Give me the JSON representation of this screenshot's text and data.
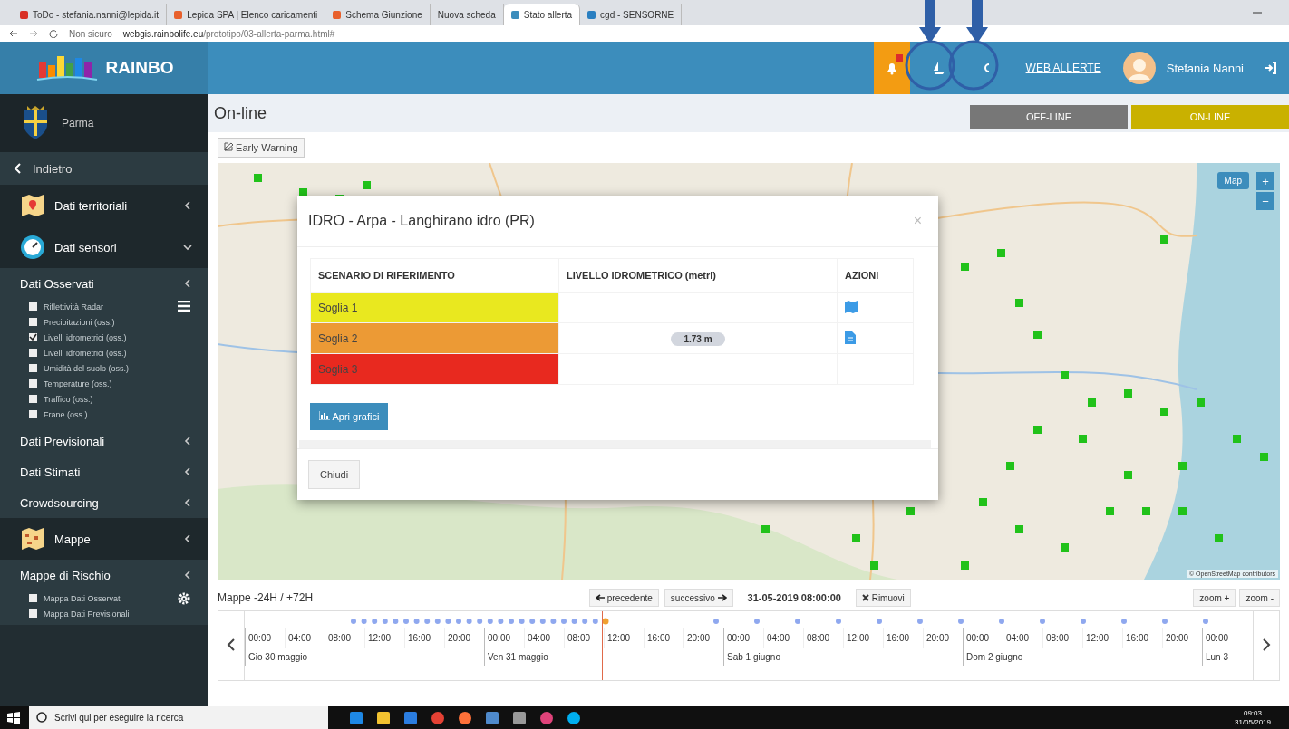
{
  "browser": {
    "tabs": [
      {
        "title": "ToDo - stefania.nanni@lepida.it",
        "selected": false,
        "color": "#d93025"
      },
      {
        "title": "Lepida SPA | Elenco caricamenti",
        "selected": false,
        "color": "#e8602c"
      },
      {
        "title": "Schema Giunzione",
        "selected": false,
        "color": "#e8602c"
      },
      {
        "title": "Nuova scheda",
        "selected": false
      },
      {
        "title": "Stato allerta",
        "selected": true,
        "color": "#3c8dbc"
      },
      {
        "title": "cgd - SENSORNE",
        "selected": false,
        "color": "#2a7fc1"
      }
    ],
    "address": {
      "security": "Non sicuro",
      "url_host": "webgis.rainbolife.eu",
      "url_path": "/prototipo/03-allerta-parma.html#"
    }
  },
  "header": {
    "logo": "RAINBO",
    "alert_active": true,
    "link": "WEB ALLERTE",
    "user": "Stefania Nanni"
  },
  "sidebar": {
    "place": "Parma",
    "back": "Indietro",
    "items": [
      {
        "kind": "main",
        "label": "Dati territoriali",
        "expanded": false
      },
      {
        "kind": "main",
        "label": "Dati sensori",
        "expanded": true
      },
      {
        "kind": "group",
        "label": "Dati Osservati",
        "expanded": false,
        "children": [
          {
            "label": "Riflettività Radar",
            "checked": false
          },
          {
            "label": "Precipitazioni (oss.)",
            "checked": false
          },
          {
            "label": "Livelli idrometrici (oss.)",
            "checked": true
          },
          {
            "label": "Livelli idrometrici (oss.)",
            "checked": false
          },
          {
            "label": "Umidità del suolo (oss.)",
            "checked": false
          },
          {
            "label": "Temperature (oss.)",
            "checked": false
          },
          {
            "label": "Traffico (oss.)",
            "checked": false
          },
          {
            "label": "Frane (oss.)",
            "checked": false
          }
        ]
      },
      {
        "kind": "group",
        "label": "Dati Previsionali",
        "expanded": false
      },
      {
        "kind": "group",
        "label": "Dati Stimati",
        "expanded": false
      },
      {
        "kind": "group",
        "label": "Crowdsourcing",
        "expanded": false
      },
      {
        "kind": "main",
        "label": "Mappe",
        "expanded": false
      },
      {
        "kind": "group",
        "label": "Mappe di Rischio",
        "expanded": false,
        "children": [
          {
            "label": "Mappa Dati Osservati",
            "checked": false
          },
          {
            "label": "Mappa Dati Previsionali",
            "checked": false
          }
        ]
      }
    ]
  },
  "main": {
    "title": "On-line",
    "modes": [
      {
        "label": "OFF-LINE",
        "selected": false
      },
      {
        "label": "ON-LINE",
        "selected": true
      }
    ],
    "early_warning": "Early Warning",
    "map": {
      "map_button": "Map",
      "zoom_in": "+",
      "zoom_out": "−",
      "attribution": "© OpenStreetMap contributors"
    },
    "modal": {
      "title": "IDRO - Arpa - Langhirano idro (PR)",
      "close": "×",
      "columns": [
        "SCENARIO DI RIFERIMENTO",
        "LIVELLO IDROMETRICO (metri)",
        "AZIONI"
      ],
      "rows": [
        {
          "scenario": "Soglia 1",
          "color": "#e9e81f"
        },
        {
          "scenario": "Soglia 2",
          "color": "#ec9a35",
          "level": "1.73 m"
        },
        {
          "scenario": "Soglia 3",
          "color": "#e8291f"
        }
      ],
      "chart_button": "Apri grafici",
      "footer_button": "Chiudi"
    },
    "timeline": {
      "title": "Mappe -24H / +72H",
      "prev": "precedente",
      "next": "successivo",
      "datetime": "31-05-2019 08:00:00",
      "remove": "Rimuovi",
      "zoom_in": "zoom +",
      "zoom_out": "zoom -",
      "hours": [
        "00:00",
        "04:00",
        "08:00",
        "12:00",
        "16:00",
        "20:00",
        "00:00",
        "04:00",
        "08:00",
        "12:00",
        "16:00",
        "20:00",
        "00:00",
        "04:00",
        "08:00",
        "12:00",
        "16:00",
        "20:00",
        "00:00",
        "04:00",
        "08:00",
        "12:00",
        "16:00",
        "20:00",
        "00:00"
      ],
      "days": [
        "Gio 30 maggio",
        "Ven 31 maggio",
        "Sab 1 giugno",
        "Dom 2 giugno",
        "Lun 3"
      ]
    }
  },
  "taskbar": {
    "placeholder": "Scrivi qui per eseguire la ricerca",
    "time": "09:03",
    "date": "31/05/2019"
  }
}
